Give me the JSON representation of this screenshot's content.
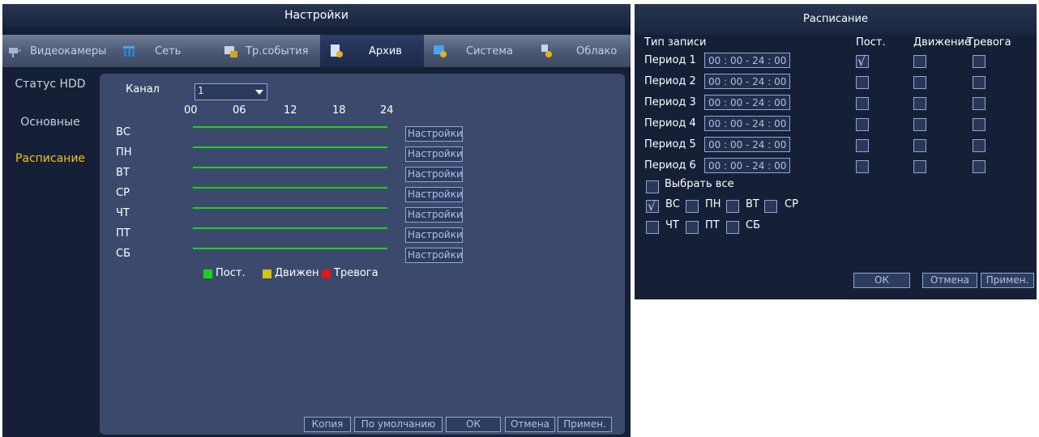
{
  "settings_window": {
    "title": "Настройки",
    "tabs": [
      {
        "label": "Видеокамеры",
        "icon": "camera-icon",
        "active": false
      },
      {
        "label": "Сеть",
        "icon": "network-icon",
        "active": false
      },
      {
        "label": "Тр.события",
        "icon": "event-icon",
        "active": false
      },
      {
        "label": "Архив",
        "icon": "archive-icon",
        "active": true
      },
      {
        "label": "Система",
        "icon": "system-icon",
        "active": false
      },
      {
        "label": "Облако",
        "icon": "cloud-icon",
        "active": false
      }
    ],
    "sidebar": [
      {
        "label": "Статус HDD",
        "active": false
      },
      {
        "label": "Основные",
        "active": false
      },
      {
        "label": "Расписание",
        "active": true
      }
    ],
    "channel": {
      "label": "Канал",
      "value": "1"
    },
    "time_scale": [
      "00",
      "06",
      "12",
      "18",
      "24"
    ],
    "days": [
      {
        "label": "ВС",
        "settings_label": "Настройки"
      },
      {
        "label": "ПН",
        "settings_label": "Настройки"
      },
      {
        "label": "ВТ",
        "settings_label": "Настройки"
      },
      {
        "label": "СР",
        "settings_label": "Настройки"
      },
      {
        "label": "ЧТ",
        "settings_label": "Настройки"
      },
      {
        "label": "ПТ",
        "settings_label": "Настройки"
      },
      {
        "label": "СБ",
        "settings_label": "Настройки"
      }
    ],
    "legend": [
      {
        "label": "Пост.",
        "color": "#1ed118"
      },
      {
        "label": "Движен",
        "color": "#d4c214"
      },
      {
        "label": "Тревога",
        "color": "#e01818"
      }
    ],
    "buttons": {
      "copy": "Копия",
      "default": "По умолчанию",
      "ok": "ОК",
      "cancel": "Отмена",
      "apply": "Примен."
    }
  },
  "schedule_window": {
    "title": "Расписание",
    "headers": {
      "record_type": "Тип записи",
      "regular": "Пост.",
      "motion": "Движение",
      "alarm": "Тревога"
    },
    "periods": [
      {
        "label": "Период 1",
        "time": "00 : 00 - 24 : 00",
        "regular": true,
        "motion": false,
        "alarm": false
      },
      {
        "label": "Период 2",
        "time": "00 : 00 - 24 : 00",
        "regular": false,
        "motion": false,
        "alarm": false
      },
      {
        "label": "Период 3",
        "time": "00 : 00 - 24 : 00",
        "regular": false,
        "motion": false,
        "alarm": false
      },
      {
        "label": "Период 4",
        "time": "00 : 00 - 24 : 00",
        "regular": false,
        "motion": false,
        "alarm": false
      },
      {
        "label": "Период 5",
        "time": "00 : 00 - 24 : 00",
        "regular": false,
        "motion": false,
        "alarm": false
      },
      {
        "label": "Период 6",
        "time": "00 : 00 - 24 : 00",
        "regular": false,
        "motion": false,
        "alarm": false
      }
    ],
    "select_all": {
      "label": "Выбрать все",
      "checked": false
    },
    "days": [
      {
        "label": "ВС",
        "checked": true
      },
      {
        "label": "ПН",
        "checked": false
      },
      {
        "label": "ВТ",
        "checked": false
      },
      {
        "label": "СР",
        "checked": false
      },
      {
        "label": "ЧТ",
        "checked": false
      },
      {
        "label": "ПТ",
        "checked": false
      },
      {
        "label": "СБ",
        "checked": false
      }
    ],
    "buttons": {
      "ok": "ОК",
      "cancel": "Отмена",
      "apply": "Примен."
    }
  }
}
